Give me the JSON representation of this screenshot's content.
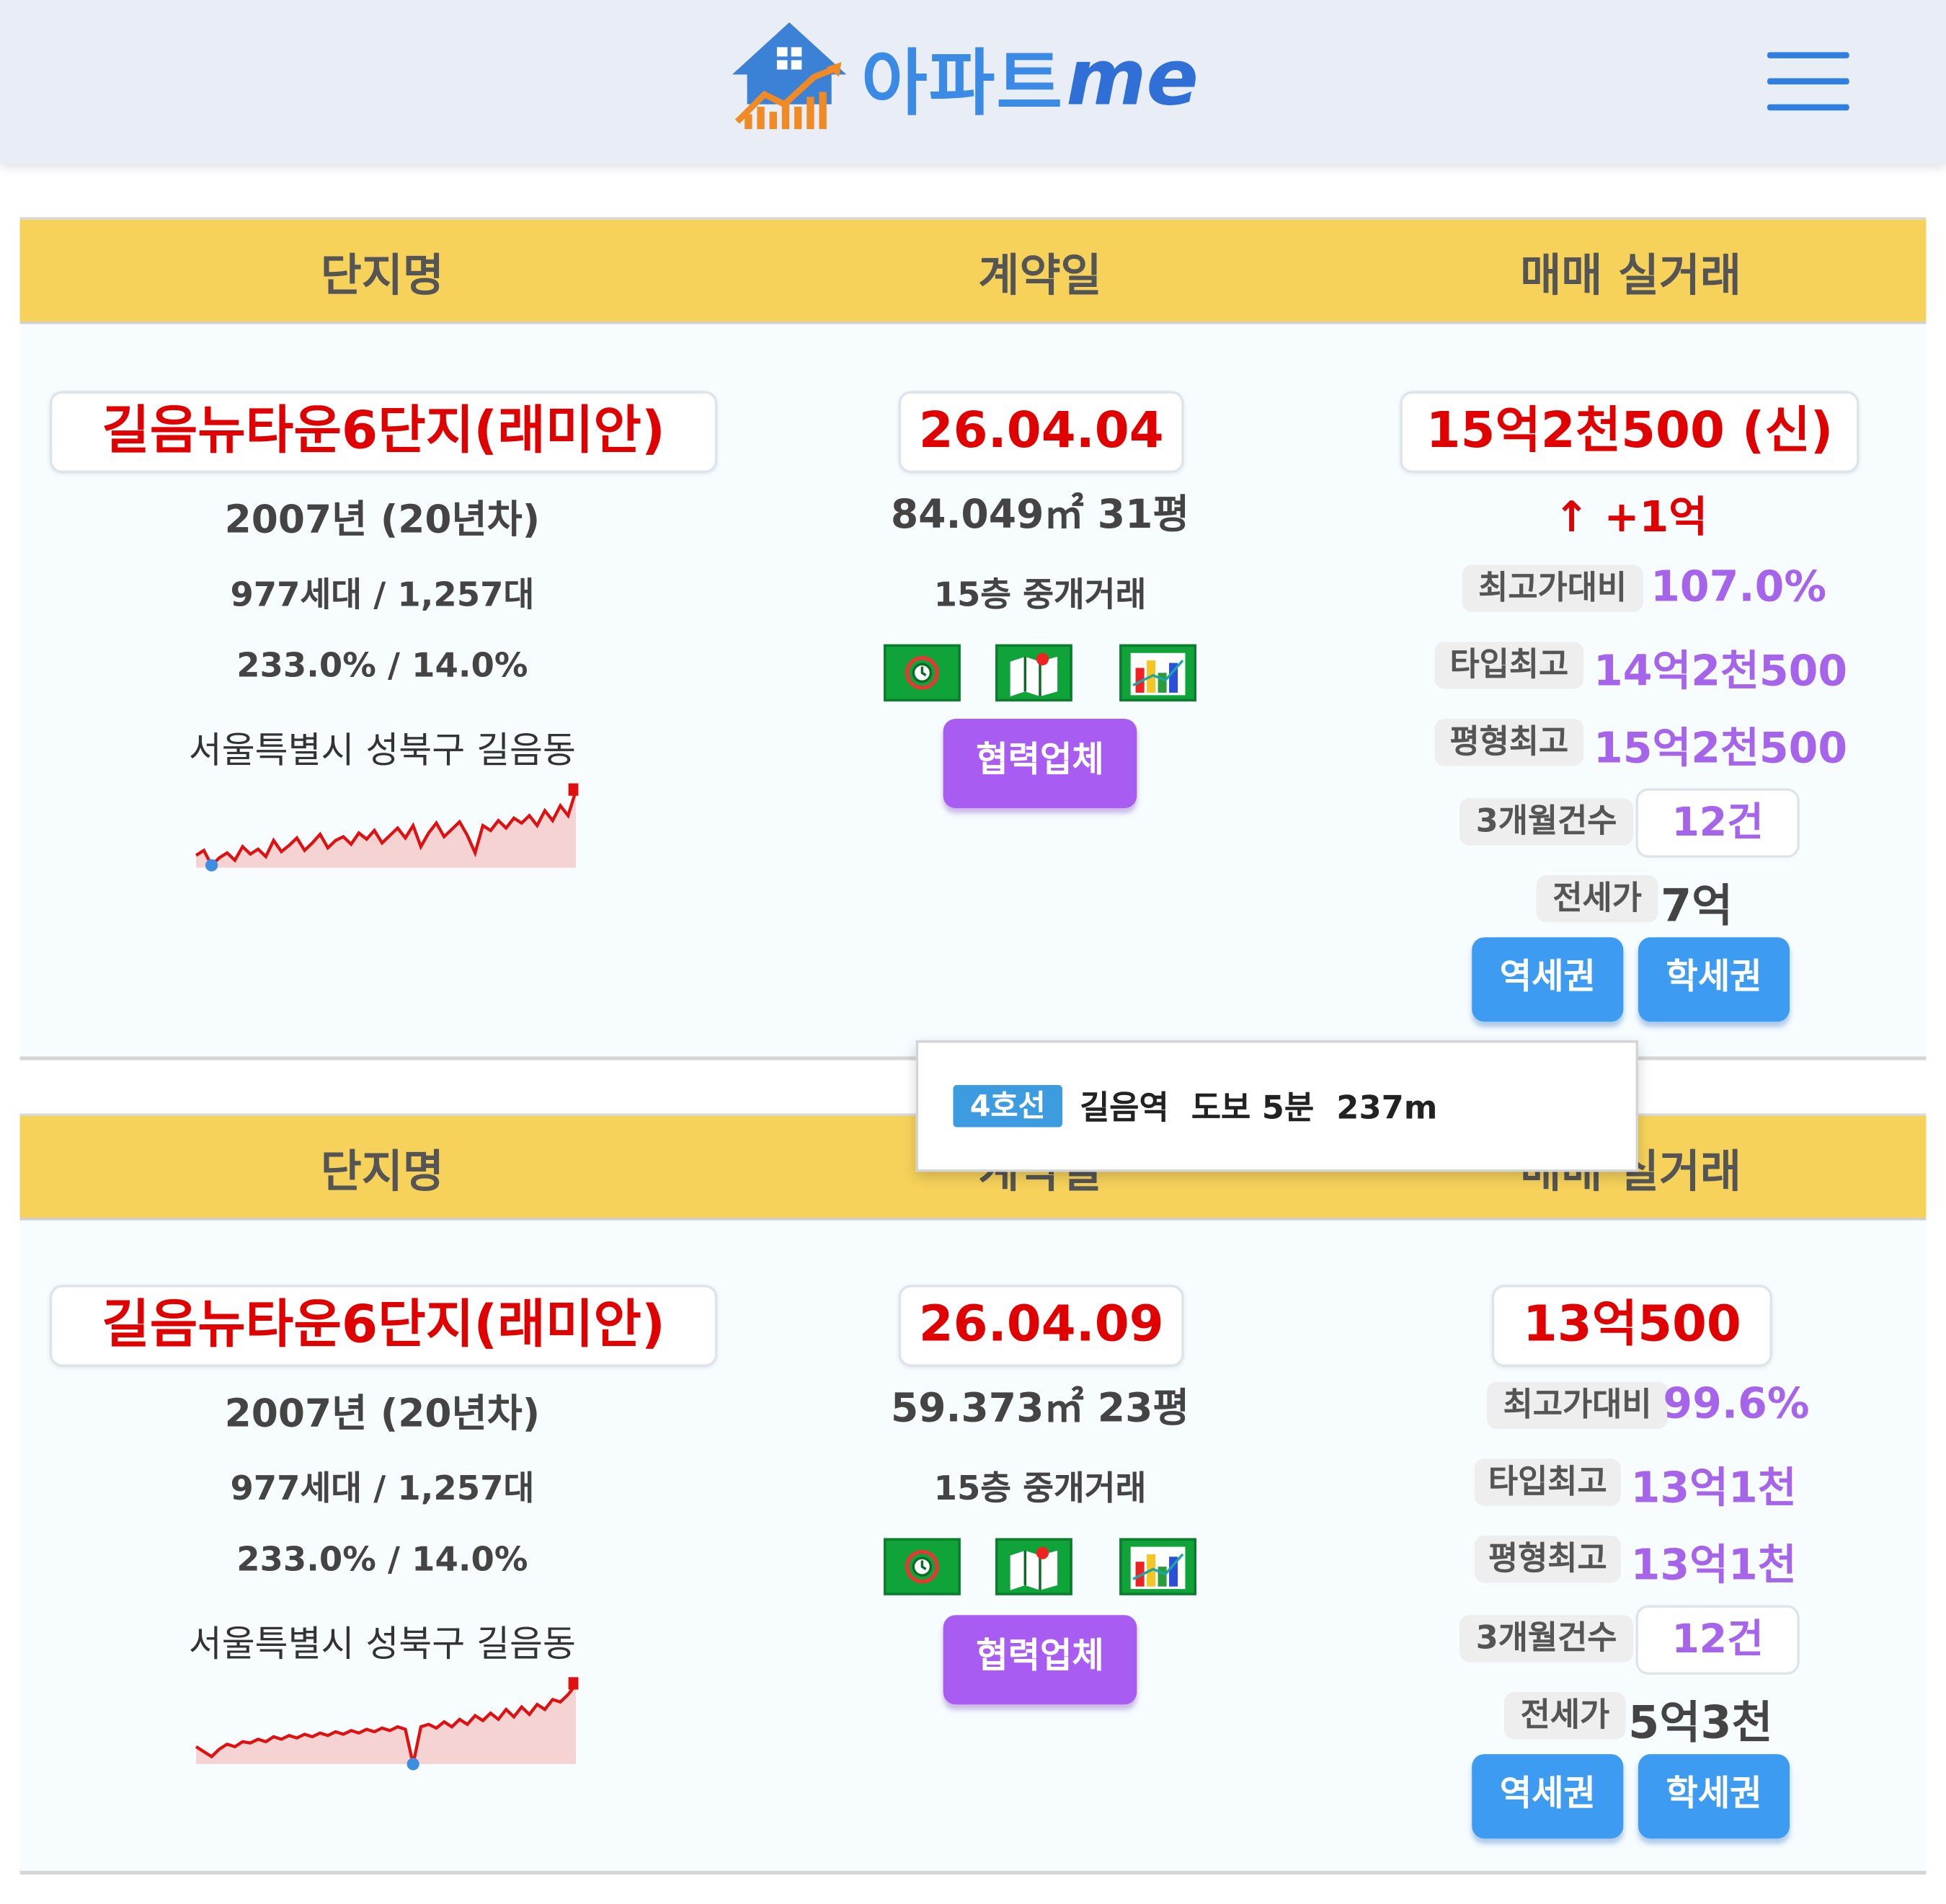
{
  "app": {
    "logo_word": "아파트",
    "logo_suffix": "me"
  },
  "columns": {
    "name": "단지명",
    "date": "계약일",
    "price": "매매 실거래"
  },
  "tooltip": {
    "line": "4호선",
    "text": "길음역  도보 5분  237m"
  },
  "listings": [
    {
      "complex_name": "길음뉴타운6단지(래미안)",
      "built": "2007년 (20년차)",
      "households": "977세대 / 1,257대",
      "ratios": "233.0% / 14.0%",
      "address": "서울특별시 성북구 길음동",
      "contract_date": "26.04.04",
      "area": "84.049㎡ 31평",
      "floor": "15층 중개거래",
      "partner_label": "협력업체",
      "price": "15억2천500 (신)",
      "change": "↑ +1억",
      "max_ratio_label": "최고가대비",
      "max_ratio": "107.0%",
      "type_max_label": "타입최고",
      "type_max": "14억2천500",
      "pyeong_max_label": "평형최고",
      "pyeong_max": "15억2천500",
      "count_label": "3개월건수",
      "count": "12건",
      "jeonse_label": "전세가",
      "jeonse": "7억",
      "station_btn": "역세권",
      "school_btn": "학세권",
      "sparkline": [
        62,
        58,
        70,
        64,
        60,
        66,
        55,
        61,
        57,
        63,
        50,
        59,
        54,
        48,
        58,
        52,
        45,
        56,
        50,
        47,
        53,
        44,
        49,
        42,
        52,
        46,
        40,
        48,
        38,
        55,
        44,
        36,
        47,
        41,
        35,
        46,
        60,
        38,
        42,
        34,
        40,
        32,
        36,
        30,
        38,
        26,
        34,
        22,
        30,
        10
      ]
    },
    {
      "complex_name": "길음뉴타운6단지(래미안)",
      "built": "2007년 (20년차)",
      "households": "977세대 / 1,257대",
      "ratios": "233.0% / 14.0%",
      "address": "서울특별시 성북구 길음동",
      "contract_date": "26.04.09",
      "area": "59.373㎡ 23평",
      "floor": "15층 중개거래",
      "partner_label": "협력업체",
      "price": "13억500",
      "max_ratio_label": "최고가대비",
      "max_ratio": "99.6%",
      "type_max_label": "타입최고",
      "type_max": "13억1천",
      "pyeong_max_label": "평형최고",
      "pyeong_max": "13억1천",
      "count_label": "3개월건수",
      "count": "12건",
      "jeonse_label": "전세가",
      "jeonse": "5억3천",
      "station_btn": "역세권",
      "school_btn": "학세권",
      "sparkline": [
        58,
        62,
        66,
        60,
        56,
        58,
        54,
        55,
        52,
        54,
        50,
        52,
        49,
        51,
        48,
        50,
        47,
        49,
        46,
        48,
        45,
        47,
        44,
        46,
        43,
        45,
        42,
        44,
        72,
        42,
        40,
        43,
        38,
        42,
        36,
        40,
        33,
        37,
        31,
        36,
        28,
        34,
        26,
        32,
        24,
        28,
        20,
        22,
        16,
        8
      ]
    }
  ]
}
